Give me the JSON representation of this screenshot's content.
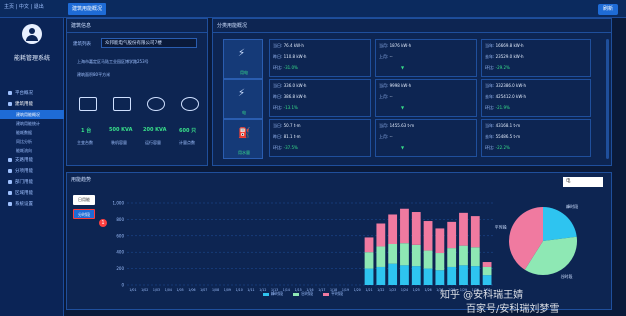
{
  "topbar": {
    "tools": "主页 | 中文 | 退出",
    "tab_label": "建筑用能概况",
    "right_button": "刷新"
  },
  "sidebar": {
    "system_name": "能耗管理系统",
    "items": [
      {
        "label": "平台概况",
        "active": false
      },
      {
        "label": "建筑用能",
        "active": true
      },
      {
        "label": "建筑用能概况",
        "sub": true,
        "active": true
      },
      {
        "label": "建筑用能统计",
        "sub": true,
        "active": false
      },
      {
        "label": "能耗数据",
        "sub": true,
        "active": false
      },
      {
        "label": "同比分析",
        "sub": true,
        "active": false
      },
      {
        "label": "能耗流向",
        "sub": true,
        "active": false
      },
      {
        "label": "支路用能",
        "active": false
      },
      {
        "label": "分项用能",
        "active": false
      },
      {
        "label": "部门用能",
        "active": false
      },
      {
        "label": "区域用能",
        "active": false
      },
      {
        "label": "系统设置",
        "active": false
      }
    ]
  },
  "building_panel": {
    "title": "建筑信息",
    "select_label": "建筑列表",
    "select_value": "众邦能电气股份有限公司7楼",
    "address": "上海市嘉定区马陆工业园区博学路253号",
    "area": "建筑面积80平方米",
    "stats": [
      {
        "value": "1 台",
        "label": "主变台数"
      },
      {
        "value": "500 KVA",
        "label": "装机容量"
      },
      {
        "value": "200 KVA",
        "label": "运行容量"
      },
      {
        "value": "600 只",
        "label": "计量点数"
      }
    ]
  },
  "energy_panel": {
    "title": "分类用能概况",
    "rows": [
      {
        "meter_label": "用电",
        "today": "76.4 kW·h",
        "yesterday": "110.8 kW·h",
        "day_ratio": "-31.0%",
        "month": "1876 kW·h",
        "last_month": "--",
        "year": "16669.8 kW·h",
        "last_year": "23529.0 kW·h",
        "year_ratio": "-29.2%"
      },
      {
        "meter_label": "电",
        "today": "336.0 kW·h",
        "yesterday": "386.8 kW·h",
        "day_ratio": "-13.1%",
        "month": "9998 kW·h",
        "last_month": "--",
        "year": "332386.0 kW·h",
        "last_year": "425412.0 kW·h",
        "year_ratio": "-21.9%"
      },
      {
        "meter_label": "用水量",
        "today": "50.7 t·m",
        "yesterday": "81.1 t·m",
        "day_ratio": "-37.5%",
        "month": "1455.63 t·m",
        "last_month": "--",
        "year": "43168.1 t·m",
        "last_year": "55486.5 t·m",
        "year_ratio": "-22.2%"
      }
    ],
    "labels": {
      "today": "当日:",
      "yesterday": "昨日:",
      "ratio": "环比:",
      "month": "当月:",
      "last_month": "上月:",
      "year": "当年:",
      "last_year": "去年:"
    }
  },
  "chart": {
    "title": "用能趋势",
    "tab_a": "日用能",
    "tab_b": "分时段",
    "badge": "1",
    "select_value": "电",
    "legend": [
      "峰时段",
      "谷时段",
      "平时段"
    ],
    "colors": {
      "blue": "#2ec4f0",
      "green": "#8ee8b4",
      "pink": "#f07aa0"
    }
  },
  "chart_data": {
    "type": "bar",
    "ylim": [
      0,
      1000
    ],
    "yticks": [
      0,
      200,
      400,
      600,
      800,
      1000
    ],
    "categories": [
      "1/01",
      "1/02",
      "1/03",
      "1/04",
      "1/05",
      "1/06",
      "1/07",
      "1/08",
      "1/09",
      "1/10",
      "1/11",
      "1/12",
      "1/13",
      "1/14",
      "1/15",
      "1/16",
      "1/17",
      "1/18",
      "1/19",
      "1/20",
      "1/21",
      "1/22",
      "1/23",
      "1/24",
      "1/25",
      "1/26",
      "1/27",
      "1/28",
      "1/29",
      "1/30",
      "1/31"
    ],
    "series": [
      {
        "name": "峰时段",
        "values": [
          0,
          0,
          0,
          0,
          0,
          0,
          0,
          0,
          0,
          0,
          0,
          0,
          0,
          0,
          0,
          0,
          0,
          0,
          0,
          0,
          200,
          220,
          260,
          240,
          230,
          200,
          180,
          220,
          240,
          230,
          120
        ]
      },
      {
        "name": "谷时段",
        "values": [
          0,
          0,
          0,
          0,
          0,
          0,
          0,
          0,
          0,
          0,
          0,
          0,
          0,
          0,
          0,
          0,
          0,
          0,
          0,
          0,
          200,
          250,
          240,
          270,
          260,
          220,
          210,
          230,
          240,
          230,
          100
        ]
      },
      {
        "name": "平时段",
        "values": [
          0,
          0,
          0,
          0,
          0,
          0,
          0,
          0,
          0,
          0,
          0,
          0,
          0,
          0,
          0,
          0,
          0,
          0,
          0,
          0,
          180,
          280,
          360,
          420,
          400,
          360,
          300,
          320,
          400,
          380,
          60
        ]
      }
    ],
    "pie": [
      {
        "name": "峰时段",
        "value": 0.23
      },
      {
        "name": "谷时段",
        "value": 0.36
      },
      {
        "name": "平时段",
        "value": 0.41
      }
    ]
  },
  "watermark": {
    "line1": "知乎 @安科瑞王婧",
    "line2": "百家号/安科瑞刘梦雪"
  }
}
